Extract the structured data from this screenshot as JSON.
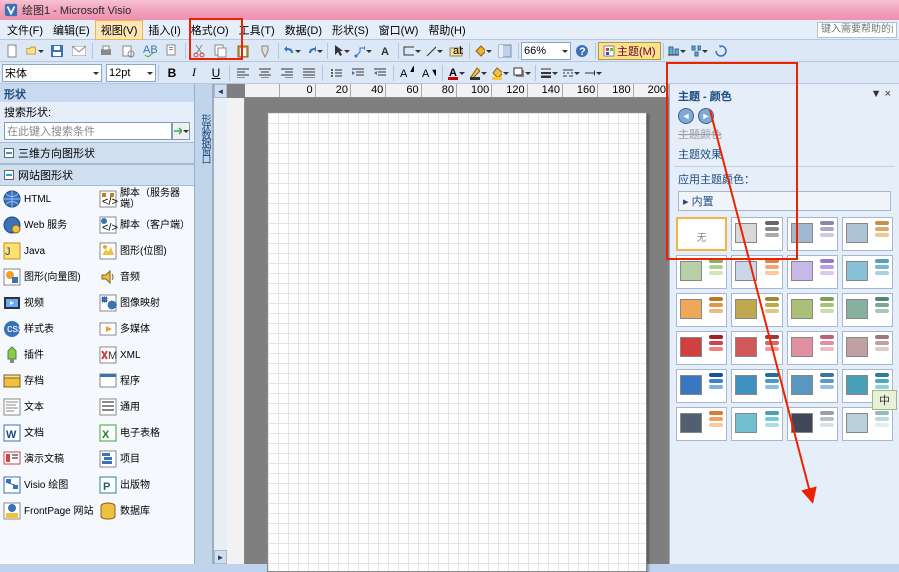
{
  "titlebar": {
    "app_icon_name": "visio-icon",
    "title": "绘图1 - Microsoft Visio"
  },
  "menubar": {
    "items": [
      {
        "label": "文件(F)",
        "u": "F"
      },
      {
        "label": "编辑(E)",
        "u": "E"
      },
      {
        "label": "视图(V)",
        "u": "V"
      },
      {
        "label": "插入(I)",
        "u": "I"
      },
      {
        "label": "格式(O)",
        "u": "O"
      },
      {
        "label": "工具(T)",
        "u": "T"
      },
      {
        "label": "数据(D)",
        "u": "D"
      },
      {
        "label": "形状(S)",
        "u": "S"
      },
      {
        "label": "窗口(W)",
        "u": "W"
      },
      {
        "label": "帮助(H)",
        "u": "H"
      }
    ],
    "help_placeholder": "键入需要帮助的问"
  },
  "toolbar1": {
    "zoom_value": "66%",
    "theme_label": "主题(M)"
  },
  "toolbar2": {
    "font_value": "宋体",
    "size_value": "12pt"
  },
  "shapes": {
    "title": "形状",
    "search_label": "搜索形状:",
    "search_placeholder": "在此键入搜索条件",
    "categories": [
      "三维方向图形状",
      "网站图形状"
    ],
    "items_left": [
      {
        "label": "HTML",
        "icon": "globe-icon"
      },
      {
        "label": "Web 服务",
        "icon": "gear-globe-icon"
      },
      {
        "label": "Java",
        "icon": "java-icon"
      },
      {
        "label": "图形(向量图)",
        "icon": "vector-icon"
      },
      {
        "label": "视频",
        "icon": "video-icon"
      },
      {
        "label": "样式表",
        "icon": "css-icon"
      },
      {
        "label": "插件",
        "icon": "plugin-icon"
      },
      {
        "label": "存档",
        "icon": "archive-icon"
      },
      {
        "label": "文本",
        "icon": "text-icon"
      },
      {
        "label": "文档",
        "icon": "word-icon"
      },
      {
        "label": "演示文稿",
        "icon": "presentation-icon"
      },
      {
        "label": "Visio 绘图",
        "icon": "visio-drawing-icon"
      },
      {
        "label": "FrontPage 网站",
        "icon": "frontpage-icon"
      }
    ],
    "items_right": [
      {
        "label": "脚本（服务器端）",
        "icon": "script-server-icon"
      },
      {
        "label": "脚本（客户端）",
        "icon": "script-client-icon"
      },
      {
        "label": "图形(位图)",
        "icon": "bitmap-icon"
      },
      {
        "label": "音频",
        "icon": "audio-icon"
      },
      {
        "label": "图像映射",
        "icon": "imagemap-icon"
      },
      {
        "label": "多媒体",
        "icon": "media-icon"
      },
      {
        "label": "XML",
        "icon": "xml-icon"
      },
      {
        "label": "程序",
        "icon": "program-icon"
      },
      {
        "label": "通用",
        "icon": "generic-icon"
      },
      {
        "label": "电子表格",
        "icon": "excel-icon"
      },
      {
        "label": "项目",
        "icon": "project-icon"
      },
      {
        "label": "出版物",
        "icon": "publisher-icon"
      },
      {
        "label": "数据库",
        "icon": "database-icon"
      }
    ]
  },
  "ruler": {
    "marks": [
      "",
      "0",
      "20",
      "40",
      "60",
      "80",
      "100",
      "120",
      "140",
      "160",
      "180",
      "200"
    ]
  },
  "theme_pane": {
    "title": "主题 - 颜色",
    "link1": "主题颜色",
    "link2": "主题效果",
    "section": "应用主题颜色：",
    "group": "内置",
    "none_label": "无",
    "swatches": [
      {
        "rect": "#d8d8d8",
        "bars": [
          "#666",
          "#888",
          "#aaa"
        ]
      },
      {
        "rect": "#a0b8d0",
        "bars": [
          "#88a",
          "#aac",
          "#ccd"
        ]
      },
      {
        "rect": "#b0c4d8",
        "bars": [
          "#c69050",
          "#e0a868",
          "#f0c890"
        ]
      },
      {
        "rect": "#b8d0a8",
        "bars": [
          "#8ab068",
          "#b0d090",
          "#d0e8b8"
        ]
      },
      {
        "rect": "#c8d8e8",
        "bars": [
          "#e08050",
          "#f0a870",
          "#f8c8a0"
        ]
      },
      {
        "rect": "#c8b8e8",
        "bars": [
          "#9878c8",
          "#b8a0e0",
          "#d8c8f0"
        ]
      },
      {
        "rect": "#88c0d8",
        "bars": [
          "#50a0c0",
          "#78b8d0",
          "#a8d0e0"
        ]
      },
      {
        "rect": "#f0a858",
        "bars": [
          "#c07820",
          "#e09850",
          "#f0b880"
        ]
      },
      {
        "rect": "#c0a850",
        "bars": [
          "#a08830",
          "#c0a850",
          "#e0c880"
        ]
      },
      {
        "rect": "#a8c078",
        "bars": [
          "#80a050",
          "#a8c078",
          "#c8e0a8"
        ]
      },
      {
        "rect": "#88b0a0",
        "bars": [
          "#508878",
          "#78a898",
          "#a8c8b8"
        ]
      },
      {
        "rect": "#d04040",
        "bars": [
          "#a02020",
          "#d04050",
          "#f08080"
        ]
      },
      {
        "rect": "#d05858",
        "bars": [
          "#a03838",
          "#d06868",
          "#f09898"
        ]
      },
      {
        "rect": "#e090a0",
        "bars": [
          "#c06078",
          "#e090a0",
          "#f0b8c8"
        ]
      },
      {
        "rect": "#c0a0a0",
        "bars": [
          "#a07878",
          "#c0a0a0",
          "#e0c8c8"
        ]
      },
      {
        "rect": "#3878c0",
        "bars": [
          "#1850a0",
          "#4080c8",
          "#80b0e0"
        ]
      },
      {
        "rect": "#4090c0",
        "bars": [
          "#2070a0",
          "#4898c8",
          "#88c0e0"
        ]
      },
      {
        "rect": "#5898c0",
        "bars": [
          "#3878a0",
          "#6098c0",
          "#98c0e0"
        ]
      },
      {
        "rect": "#48a0b8",
        "bars": [
          "#288098",
          "#50a8c0",
          "#90d0e0"
        ]
      },
      {
        "rect": "#506070",
        "bars": [
          "#e07830",
          "#f0a060",
          "#f8c898"
        ]
      },
      {
        "rect": "#70c0d0",
        "bars": [
          "#48a0b0",
          "#78c8d8",
          "#a8e0e8"
        ]
      },
      {
        "rect": "#404858",
        "bars": [
          "#98a0b0",
          "#b8c0c8",
          "#d8e0e8"
        ]
      },
      {
        "rect": "#b8d0d8",
        "bars": [
          "#98b8c0",
          "#c0d8e0",
          "#e0f0f0"
        ]
      }
    ]
  },
  "ime_badge": "中",
  "vtab_label": "形状数据窗口"
}
